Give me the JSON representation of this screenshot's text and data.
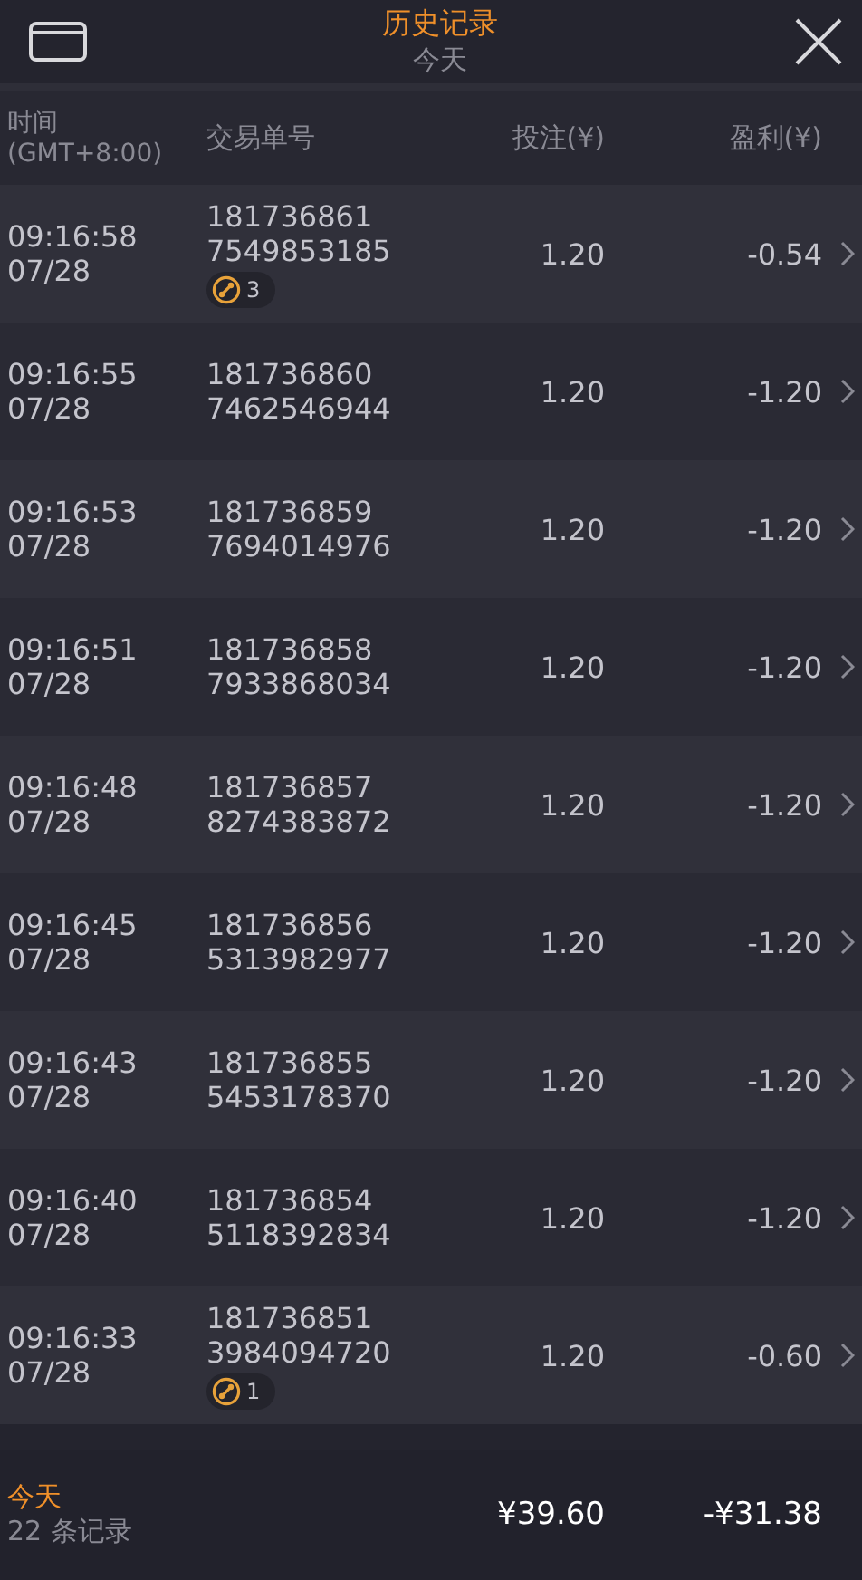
{
  "header": {
    "title": "历史记录",
    "subtitle": "今天"
  },
  "columns": {
    "time": "时间",
    "timezone": "(GMT+8:00)",
    "order": "交易单号",
    "stake": "投注(¥)",
    "profit": "盈利(¥)"
  },
  "rows": [
    {
      "time": "09:16:58",
      "date": "07/28",
      "order_1": "181736861",
      "order_2": "7549853185",
      "stake": "1.20",
      "profit": "-0.54",
      "badge": "3"
    },
    {
      "time": "09:16:55",
      "date": "07/28",
      "order_1": "181736860",
      "order_2": "7462546944",
      "stake": "1.20",
      "profit": "-1.20"
    },
    {
      "time": "09:16:53",
      "date": "07/28",
      "order_1": "181736859",
      "order_2": "7694014976",
      "stake": "1.20",
      "profit": "-1.20"
    },
    {
      "time": "09:16:51",
      "date": "07/28",
      "order_1": "181736858",
      "order_2": "7933868034",
      "stake": "1.20",
      "profit": "-1.20"
    },
    {
      "time": "09:16:48",
      "date": "07/28",
      "order_1": "181736857",
      "order_2": "8274383872",
      "stake": "1.20",
      "profit": "-1.20"
    },
    {
      "time": "09:16:45",
      "date": "07/28",
      "order_1": "181736856",
      "order_2": "5313982977",
      "stake": "1.20",
      "profit": "-1.20"
    },
    {
      "time": "09:16:43",
      "date": "07/28",
      "order_1": "181736855",
      "order_2": "5453178370",
      "stake": "1.20",
      "profit": "-1.20"
    },
    {
      "time": "09:16:40",
      "date": "07/28",
      "order_1": "181736854",
      "order_2": "5118392834",
      "stake": "1.20",
      "profit": "-1.20"
    },
    {
      "time": "09:16:33",
      "date": "07/28",
      "order_1": "181736851",
      "order_2": "3984094720",
      "stake": "1.20",
      "profit": "-0.60",
      "badge": "1"
    }
  ],
  "footer": {
    "label": "今天",
    "count": "22 条记录",
    "stake_total": "¥39.60",
    "profit_total": "-¥31.38"
  }
}
